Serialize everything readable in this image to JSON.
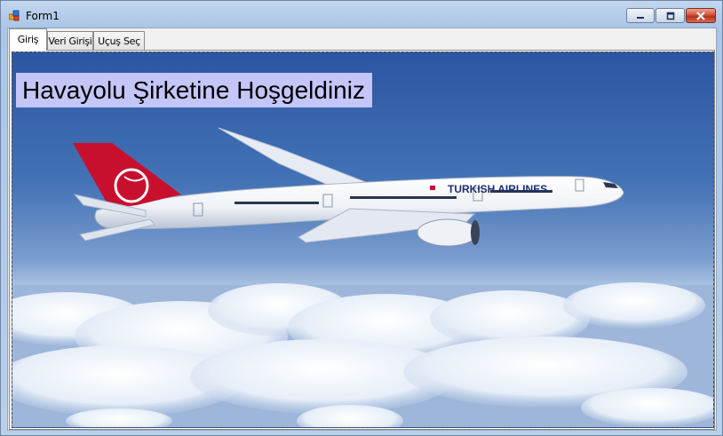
{
  "window": {
    "title": "Form1",
    "controls": [
      "minimize",
      "maximize",
      "close"
    ]
  },
  "tabs": [
    {
      "label": "Giriş",
      "active": true
    },
    {
      "label": "Veri Girişi",
      "active": false
    },
    {
      "label": "Uçuş Seç",
      "active": false
    }
  ],
  "giris_page": {
    "welcome_text": "Havayolu Şirketine Hoşgeldiniz",
    "airline_livery_text": "TURKISH AIRLINES"
  },
  "colors": {
    "welcome_bg": "#c4c6f8",
    "sky_top": "#2f5aa4",
    "livery_red": "#c8102e"
  }
}
